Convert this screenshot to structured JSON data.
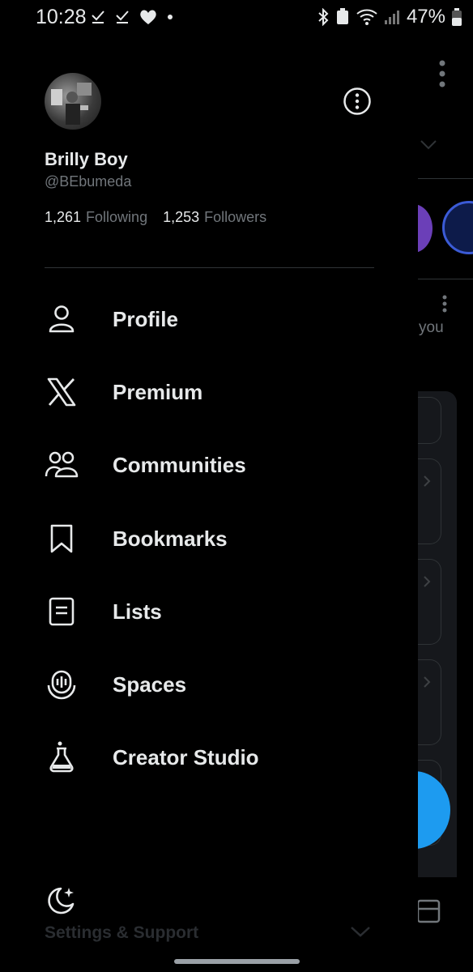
{
  "status_bar": {
    "time": "10:28",
    "battery": "47%"
  },
  "profile": {
    "name": "Brilly Boy",
    "handle": "@BEbumeda",
    "following_count": "1,261",
    "following_label": "Following",
    "followers_count": "1,253",
    "followers_label": "Followers"
  },
  "menu": [
    {
      "label": "Profile",
      "icon": "person-icon"
    },
    {
      "label": "Premium",
      "icon": "x-logo-icon"
    },
    {
      "label": "Communities",
      "icon": "communities-icon"
    },
    {
      "label": "Bookmarks",
      "icon": "bookmark-icon"
    },
    {
      "label": "Lists",
      "icon": "list-icon"
    },
    {
      "label": "Spaces",
      "icon": "spaces-icon"
    },
    {
      "label": "Creator Studio",
      "icon": "flask-icon"
    }
  ],
  "footer": {
    "settings_label": "Settings & Support"
  },
  "background": {
    "you_text": "you"
  },
  "colors": {
    "background": "#000000",
    "text": "#e7e9ea",
    "muted": "#71767b",
    "accent": "#1d9bf0"
  }
}
